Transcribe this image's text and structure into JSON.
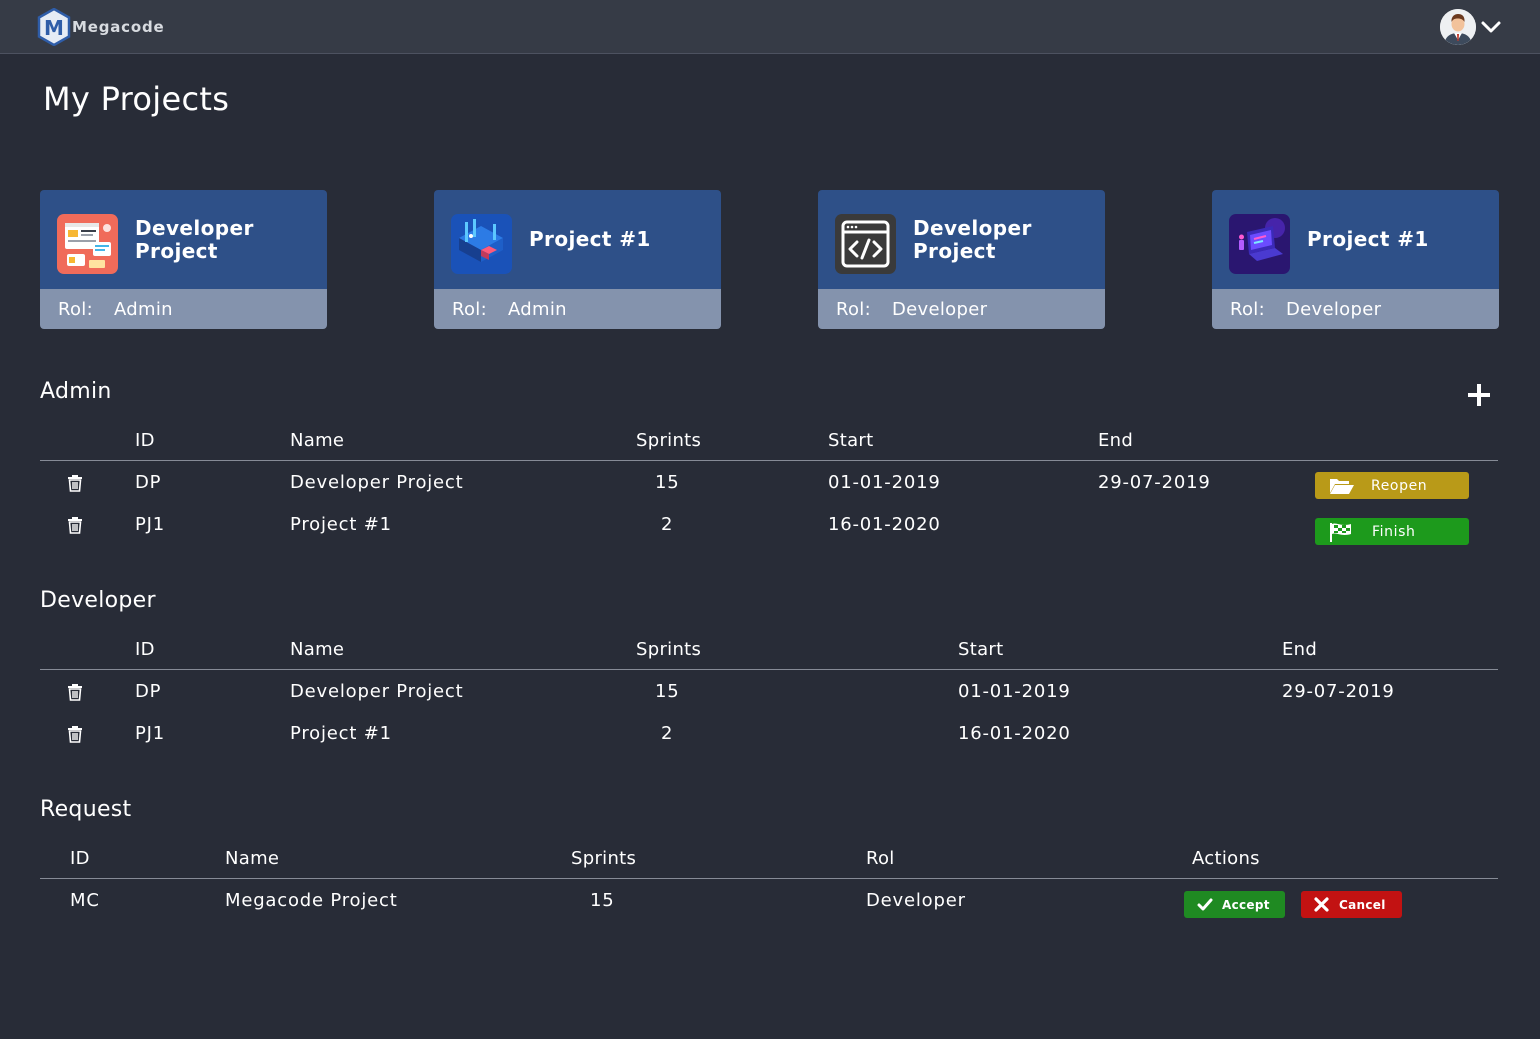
{
  "app": {
    "name": "Megacode",
    "logo_letter": "M"
  },
  "header": {
    "page_title": "My Projects"
  },
  "cards": [
    {
      "title": "Developer Project",
      "rol_label": "Rol:",
      "rol": "Admin",
      "icon": "web-design-icon"
    },
    {
      "title": "Project #1",
      "rol_label": "Rol:",
      "rol": "Admin",
      "icon": "isometric-tech-icon"
    },
    {
      "title": "Developer Project",
      "rol_label": "Rol:",
      "rol": "Developer",
      "icon": "code-window-icon"
    },
    {
      "title": "Project #1",
      "rol_label": "Rol:",
      "rol": "Developer",
      "icon": "laptop-neon-icon"
    }
  ],
  "admin": {
    "title": "Admin",
    "columns": {
      "id": "ID",
      "name": "Name",
      "sprints": "Sprints",
      "start": "Start",
      "end": "End"
    },
    "rows": [
      {
        "id": "DP",
        "name": "Developer Project",
        "sprints": "15",
        "start": "01-01-2019",
        "end": "29-07-2019",
        "action": "Reopen"
      },
      {
        "id": "PJ1",
        "name": "Project #1",
        "sprints": "2",
        "start": "16-01-2020",
        "end": "",
        "action": "Finish"
      }
    ]
  },
  "developer": {
    "title": "Developer",
    "columns": {
      "id": "ID",
      "name": "Name",
      "sprints": "Sprints",
      "start": "Start",
      "end": "End"
    },
    "rows": [
      {
        "id": "DP",
        "name": "Developer Project",
        "sprints": "15",
        "start": "01-01-2019",
        "end": "29-07-2019"
      },
      {
        "id": "PJ1",
        "name": "Project #1",
        "sprints": "2",
        "start": "16-01-2020",
        "end": ""
      }
    ]
  },
  "request": {
    "title": "Request",
    "columns": {
      "id": "ID",
      "name": "Name",
      "sprints": "Sprints",
      "rol": "Rol",
      "actions": "Actions"
    },
    "rows": [
      {
        "id": "MC",
        "name": "Megacode Project",
        "sprints": "15",
        "rol": "Developer",
        "accept": "Accept",
        "cancel": "Cancel"
      }
    ]
  },
  "colors": {
    "background": "#282c37",
    "topbar": "#363b46",
    "card_top": "#2e5088",
    "card_bottom": "#8493ad",
    "reopen": "#b99a18",
    "finish": "#1d9a1c",
    "accept": "#1f8a22",
    "cancel": "#c21212"
  }
}
